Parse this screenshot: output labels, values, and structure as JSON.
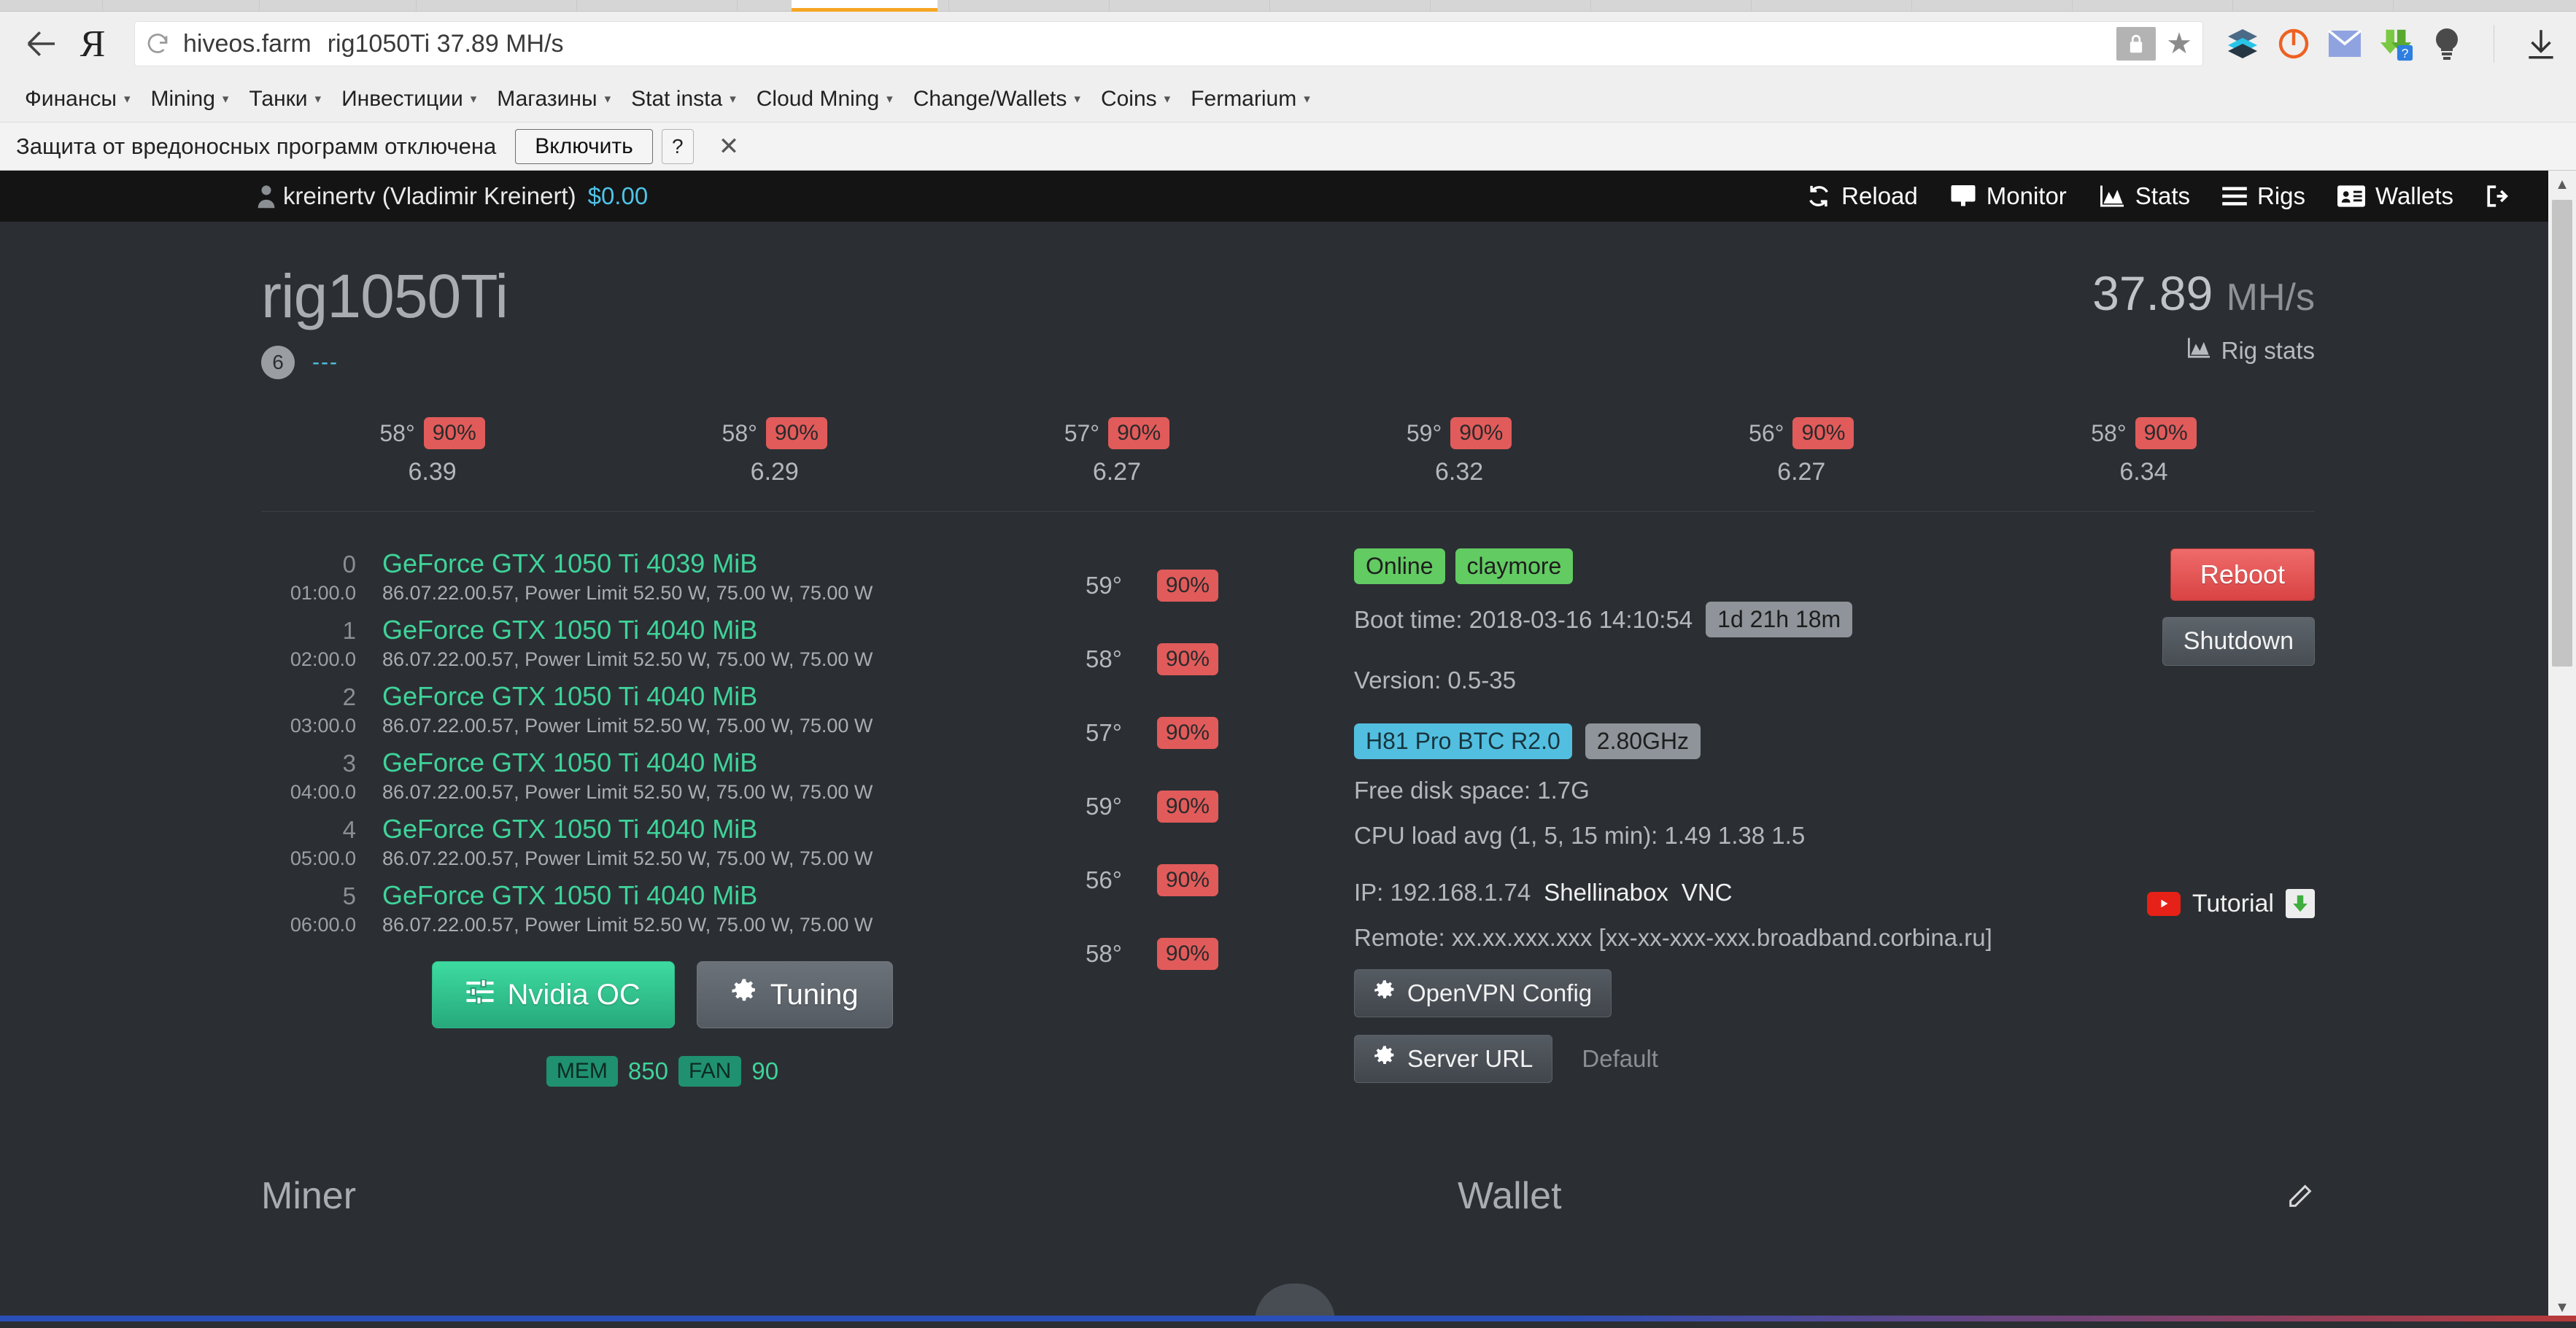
{
  "browser": {
    "back_label": "back-arrow",
    "yandex_glyph": "Я",
    "omnibox": {
      "domain": "hiveos.farm",
      "page_title": "rig1050Ti 37.89 MH/s"
    },
    "bookmarks": [
      {
        "label": "Финансы",
        "caret": "▾"
      },
      {
        "label": "Mining",
        "caret": "▾"
      },
      {
        "label": "Танки",
        "caret": "▾"
      },
      {
        "label": "Инвестиции",
        "caret": "▾"
      },
      {
        "label": "Магазины",
        "caret": "▾"
      },
      {
        "label": "Stat insta",
        "caret": "▾"
      },
      {
        "label": "Cloud Mning",
        "caret": "▾"
      },
      {
        "label": "Change/Wallets",
        "caret": "▾"
      },
      {
        "label": "Coins",
        "caret": "▾"
      },
      {
        "label": "Fermarium",
        "caret": "▾"
      }
    ],
    "infobar": {
      "message": "Защита от вредоносных программ отключена",
      "enable_button": "Включить",
      "help_button": "?",
      "close_button": "✕"
    }
  },
  "topnav": {
    "user_name": "kreinertv (Vladimir Kreinert)",
    "balance": "$0.00",
    "items": [
      {
        "label": "Reload",
        "icon": "reload-icon"
      },
      {
        "label": "Monitor",
        "icon": "monitor-icon"
      },
      {
        "label": "Stats",
        "icon": "chart-icon"
      },
      {
        "label": "Rigs",
        "icon": "hamburger-icon"
      },
      {
        "label": "Wallets",
        "icon": "id-card-icon"
      }
    ],
    "logout_icon": "logout-icon"
  },
  "rig": {
    "name": "rig1050Ti",
    "gpu_count": "6",
    "dashes": "---",
    "hashrate_value": "37.89",
    "hashrate_unit": "MH/s",
    "rig_stats_label": "Rig stats"
  },
  "summary": [
    {
      "temp": "58°",
      "load": "90%",
      "value": "6.39"
    },
    {
      "temp": "58°",
      "load": "90%",
      "value": "6.29"
    },
    {
      "temp": "57°",
      "load": "90%",
      "value": "6.27"
    },
    {
      "temp": "59°",
      "load": "90%",
      "value": "6.32"
    },
    {
      "temp": "56°",
      "load": "90%",
      "value": "6.27"
    },
    {
      "temp": "58°",
      "load": "90%",
      "value": "6.34"
    }
  ],
  "gpus": [
    {
      "index": "0",
      "name": "GeForce GTX 1050 Ti 4039 MiB",
      "bus": "01:00.0",
      "detail": "86.07.22.00.57, Power Limit 52.50 W, 75.00 W, 75.00 W",
      "temp": "59°",
      "load": "90%"
    },
    {
      "index": "1",
      "name": "GeForce GTX 1050 Ti 4040 MiB",
      "bus": "02:00.0",
      "detail": "86.07.22.00.57, Power Limit 52.50 W, 75.00 W, 75.00 W",
      "temp": "58°",
      "load": "90%"
    },
    {
      "index": "2",
      "name": "GeForce GTX 1050 Ti 4040 MiB",
      "bus": "03:00.0",
      "detail": "86.07.22.00.57, Power Limit 52.50 W, 75.00 W, 75.00 W",
      "temp": "57°",
      "load": "90%"
    },
    {
      "index": "3",
      "name": "GeForce GTX 1050 Ti 4040 MiB",
      "bus": "04:00.0",
      "detail": "86.07.22.00.57, Power Limit 52.50 W, 75.00 W, 75.00 W",
      "temp": "59°",
      "load": "90%"
    },
    {
      "index": "4",
      "name": "GeForce GTX 1050 Ti 4040 MiB",
      "bus": "05:00.0",
      "detail": "86.07.22.00.57, Power Limit 52.50 W, 75.00 W, 75.00 W",
      "temp": "56°",
      "load": "90%"
    },
    {
      "index": "5",
      "name": "GeForce GTX 1050 Ti 4040 MiB",
      "bus": "06:00.0",
      "detail": "86.07.22.00.57, Power Limit 52.50 W, 75.00 W, 75.00 W",
      "temp": "58°",
      "load": "90%"
    }
  ],
  "info": {
    "status_badge": "Online",
    "miner_badge": "claymore",
    "boot_time_label": "Boot time: 2018-03-16 14:10:54",
    "uptime_badge": "1d 21h 18m",
    "version_label": "Version: 0.5-35",
    "motherboard_badge": "H81 Pro BTC R2.0",
    "cpu_badge": "2.80GHz",
    "free_disk_label": "Free disk space: 1.7G",
    "cpu_load_label": "CPU load avg (1, 5, 15 min): 1.49 1.38 1.5",
    "ip_label": "IP: 192.168.1.74",
    "shellinabox_link": "Shellinabox",
    "vnc_link": "VNC",
    "remote_label": "Remote: xx.xx.xxx.xxx [xx-xx-xxx-xxx.broadband.corbina.ru]",
    "openvpn_button": "OpenVPN Config",
    "server_url_button": "Server URL",
    "server_url_value": "Default"
  },
  "actions": {
    "reboot_button": "Reboot",
    "shutdown_button": "Shutdown",
    "tutorial_label": "Tutorial"
  },
  "oc": {
    "nvidia_oc_button": "Nvidia OC",
    "tuning_button": "Tuning",
    "mem_tag": "MEM",
    "mem_value": "850",
    "fan_tag": "FAN",
    "fan_value": "90"
  },
  "footer": {
    "miner_title": "Miner",
    "wallet_title": "Wallet",
    "edit_icon": "edit-pencil-icon"
  }
}
